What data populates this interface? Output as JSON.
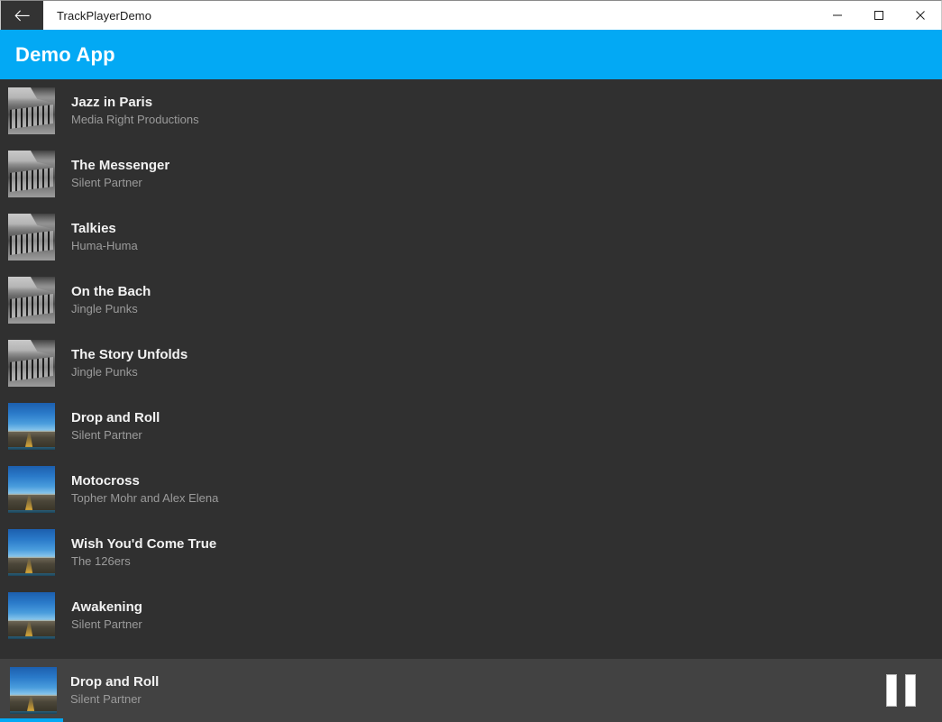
{
  "window": {
    "title": "TrackPlayerDemo",
    "back_icon": "back-arrow-icon",
    "controls": {
      "minimize": "minimize-icon",
      "maximize": "maximize-icon",
      "close": "close-icon"
    }
  },
  "app_header": {
    "title": "Demo App",
    "background": "#03a9f4"
  },
  "colors": {
    "accent": "#03a9f4",
    "list_background": "#303030",
    "player_background": "#424242",
    "title_text": "#f2f2f2",
    "artist_text": "#9b9b9b"
  },
  "tracks": [
    {
      "title": "Jazz in Paris",
      "artist": "Media Right Productions",
      "artwork": "pier"
    },
    {
      "title": "The Messenger",
      "artist": "Silent Partner",
      "artwork": "pier"
    },
    {
      "title": "Talkies",
      "artist": "Huma-Huma",
      "artwork": "pier"
    },
    {
      "title": "On the Bach",
      "artist": "Jingle Punks",
      "artwork": "pier"
    },
    {
      "title": "The Story Unfolds",
      "artist": "Jingle Punks",
      "artwork": "pier"
    },
    {
      "title": "Drop and Roll",
      "artist": "Silent Partner",
      "artwork": "road"
    },
    {
      "title": "Motocross",
      "artist": "Topher Mohr and Alex Elena",
      "artwork": "road"
    },
    {
      "title": "Wish You'd Come True",
      "artist": "The 126ers",
      "artwork": "road"
    },
    {
      "title": "Awakening",
      "artist": "Silent Partner",
      "artwork": "road"
    }
  ],
  "player": {
    "title": "Drop and Roll",
    "artist": "Silent Partner",
    "artwork": "road",
    "action_icon": "pause-icon",
    "progress_percent": 6.7
  }
}
